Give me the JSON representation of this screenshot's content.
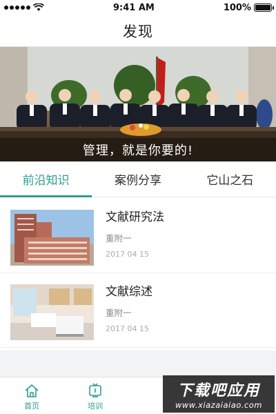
{
  "status_bar": {
    "time": "9:41 AM",
    "battery_percent": "100%",
    "battery_level": 1.0
  },
  "header": {
    "title": "发现"
  },
  "banner": {
    "caption": "管理，就是你要的!"
  },
  "tabs": [
    {
      "label": "前沿知识",
      "active": true
    },
    {
      "label": "案例分享",
      "active": false
    },
    {
      "label": "它山之石",
      "active": false
    }
  ],
  "articles": [
    {
      "title": "文献研究法",
      "author": "重附一",
      "date": "2017 04 15",
      "thumb": "hospital-building"
    },
    {
      "title": "文献综述",
      "author": "重附一",
      "date": "2017 04 15",
      "thumb": "hospital-ward"
    }
  ],
  "tabbar": [
    {
      "label": "首页",
      "icon": "home-icon"
    },
    {
      "label": "培训",
      "icon": "training-icon"
    }
  ],
  "watermark": {
    "title": "下载吧应用",
    "url": "www.xiazaiaiao.com"
  },
  "colors": {
    "accent": "#2a9d8f"
  }
}
